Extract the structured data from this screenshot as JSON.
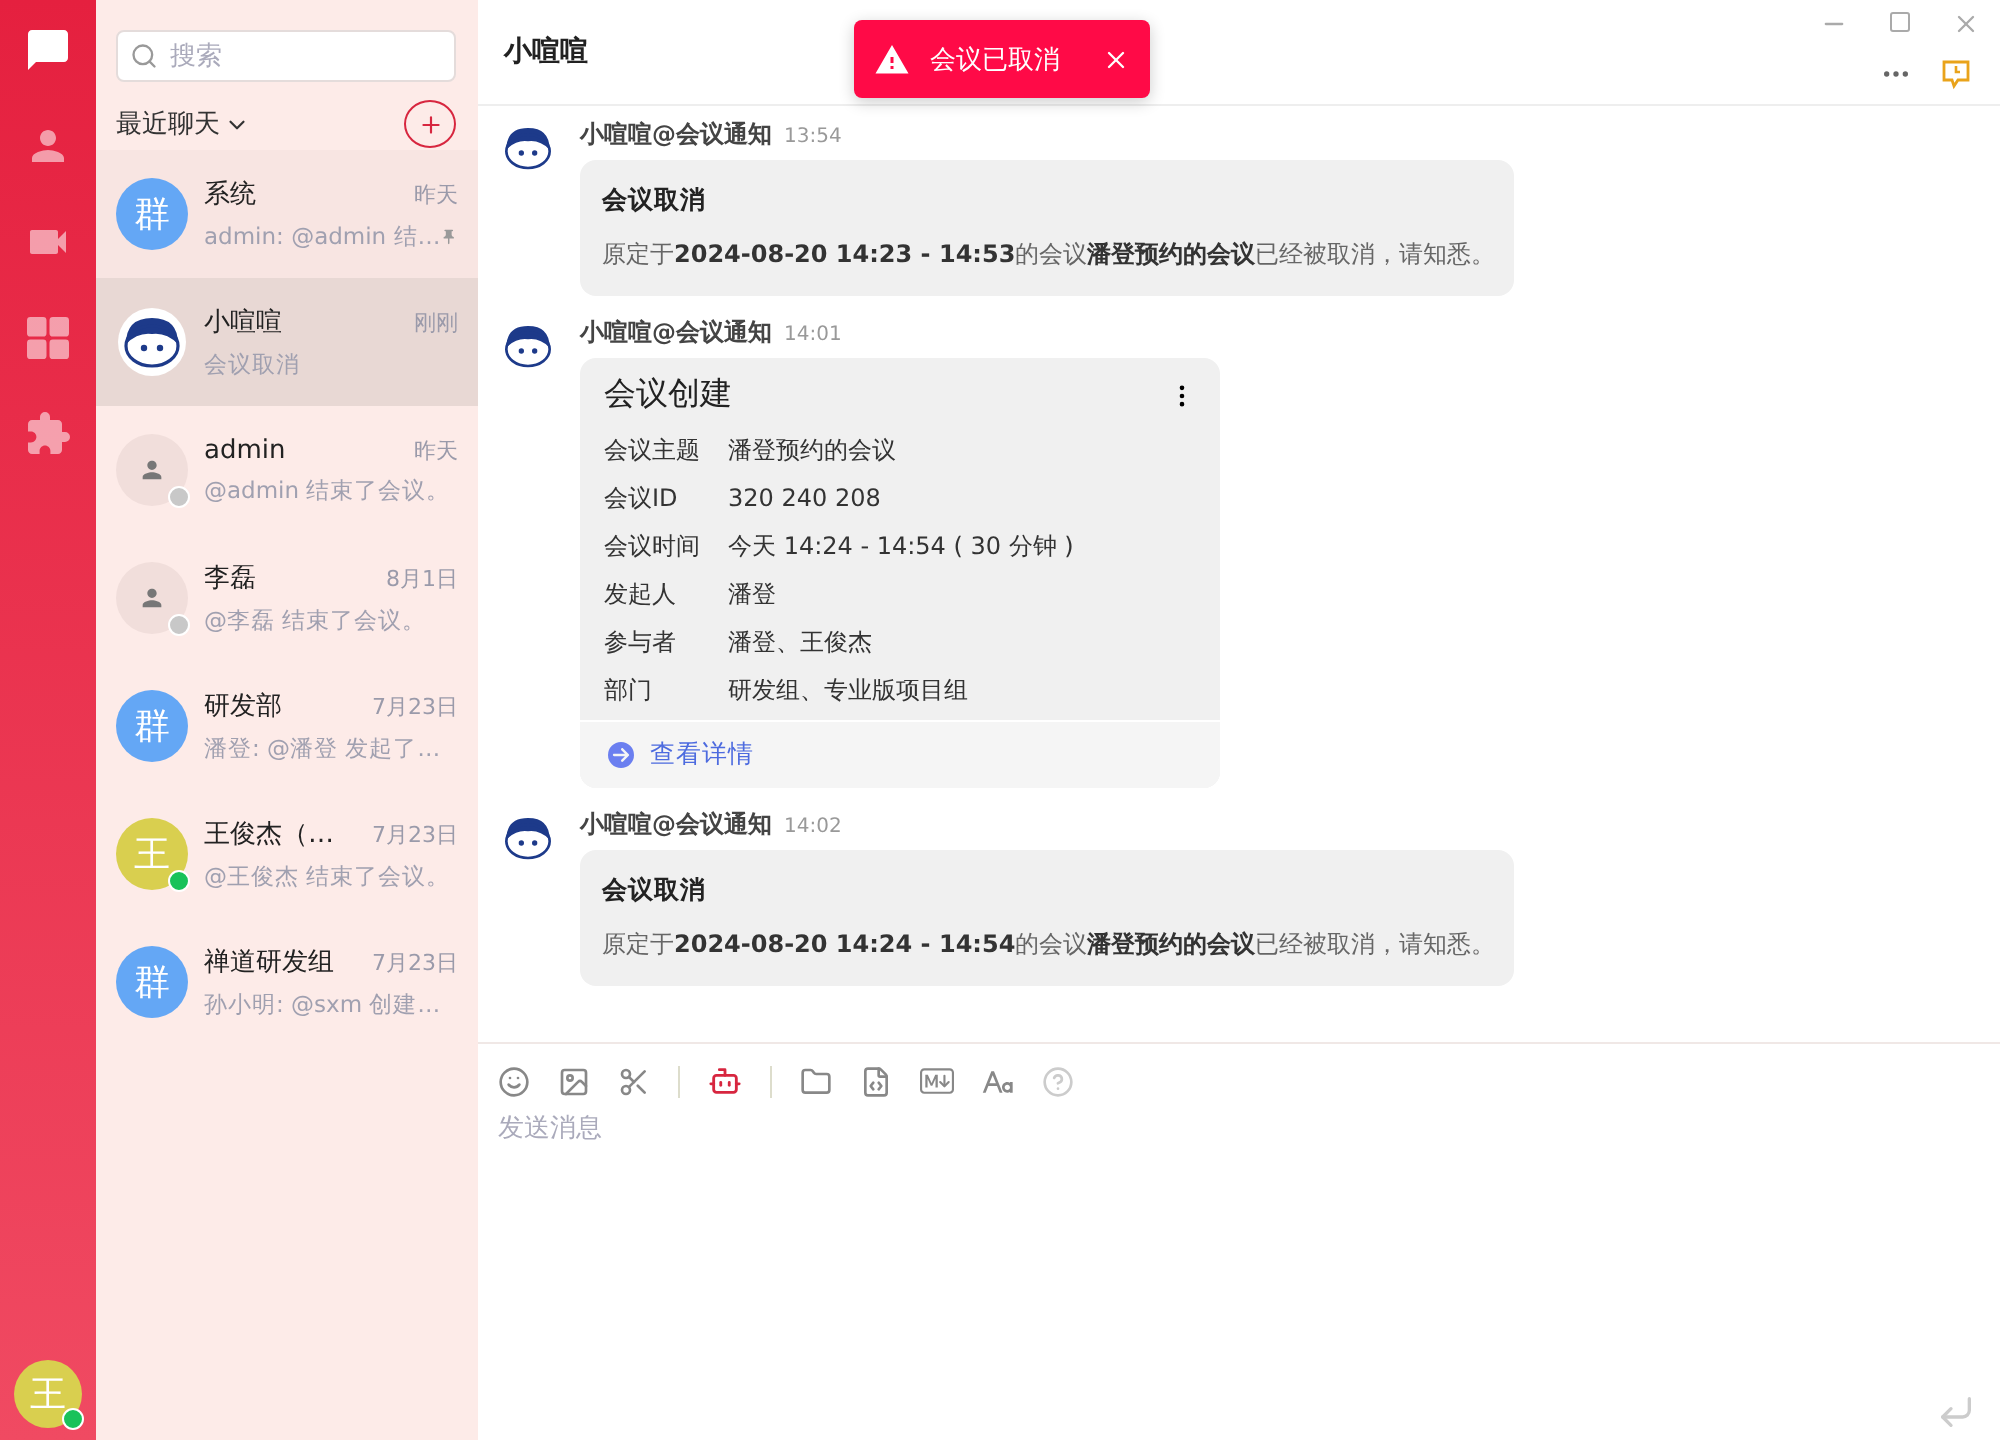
{
  "nav": {
    "items": [
      {
        "kind": "chat",
        "selected": true
      },
      {
        "kind": "contacts",
        "selected": false
      },
      {
        "kind": "video",
        "selected": false
      },
      {
        "kind": "apps",
        "selected": false
      },
      {
        "kind": "extensions",
        "selected": false
      }
    ],
    "user_avatar": {
      "letter": "王",
      "online": true
    }
  },
  "chat_list": {
    "search": {
      "placeholder": "搜索"
    },
    "filter": "最近聊天",
    "chats": [
      {
        "name": "系统",
        "time": "昨天",
        "preview": "admin: @admin 结…",
        "avatar": {
          "kind": "group",
          "text": "群"
        },
        "pinned": true,
        "selected": false
      },
      {
        "name": "小喧喧",
        "time": "刚刚",
        "preview": "会议取消",
        "avatar": {
          "kind": "mascot"
        },
        "pinned": false,
        "selected": true
      },
      {
        "name": "admin",
        "time": "昨天",
        "preview": "@admin 结束了会议。",
        "avatar": {
          "kind": "person"
        },
        "status_dot": {
          "kind": "offline"
        },
        "pinned": false,
        "selected": false
      },
      {
        "name": "李磊",
        "time": "8月1日",
        "preview": "@李磊 结束了会议。",
        "avatar": {
          "kind": "person"
        },
        "status_dot": {
          "kind": "offline"
        },
        "pinned": false,
        "selected": false
      },
      {
        "name": "研发部",
        "time": "7月23日",
        "preview": "潘登: @潘登 发起了…",
        "avatar": {
          "kind": "group",
          "text": "群"
        },
        "pinned": false,
        "selected": false
      },
      {
        "name": "王俊杰（…",
        "time": "7月23日",
        "preview": "@王俊杰 结束了会议。",
        "avatar": {
          "kind": "letter",
          "text": "王"
        },
        "status_dot": {
          "kind": "online"
        },
        "pinned": false,
        "selected": false
      },
      {
        "name": "禅道研发组",
        "time": "7月23日",
        "preview": "孙小明: @sxm 创建…",
        "avatar": {
          "kind": "group",
          "text": "群"
        },
        "pinned": false,
        "selected": false
      }
    ]
  },
  "chat": {
    "title": "小喧喧",
    "toast": {
      "text": "会议已取消"
    },
    "messages": [
      {
        "kind": "notice",
        "sender": "小喧喧@会议通知",
        "time": "13:54",
        "title": "会议取消",
        "body": "原定于**2024-08-20 14:23 - 14:53**的会议**潘登预约的会议**已经被取消，请知悉。"
      },
      {
        "kind": "card",
        "sender": "小喧喧@会议通知",
        "time": "14:01",
        "title": "会议创建",
        "fields": [
          {
            "label": "会议主题",
            "value": "潘登预约的会议"
          },
          {
            "label": "会议ID",
            "value": "320 240 208"
          },
          {
            "label": "会议时间",
            "value": "今天 14:24 - 14:54 ( 30 分钟 )"
          },
          {
            "label": "发起人",
            "value": "潘登"
          },
          {
            "label": "参与者",
            "value": "潘登、王俊杰"
          },
          {
            "label": "部门",
            "value": "研发组、专业版项目组"
          }
        ],
        "link": "查看详情"
      },
      {
        "kind": "notice",
        "sender": "小喧喧@会议通知",
        "time": "14:02",
        "title": "会议取消",
        "body": "原定于**2024-08-20 14:24 - 14:54**的会议**潘登预约的会议**已经被取消，请知悉。"
      }
    ],
    "composer": {
      "placeholder": "发送消息"
    }
  }
}
